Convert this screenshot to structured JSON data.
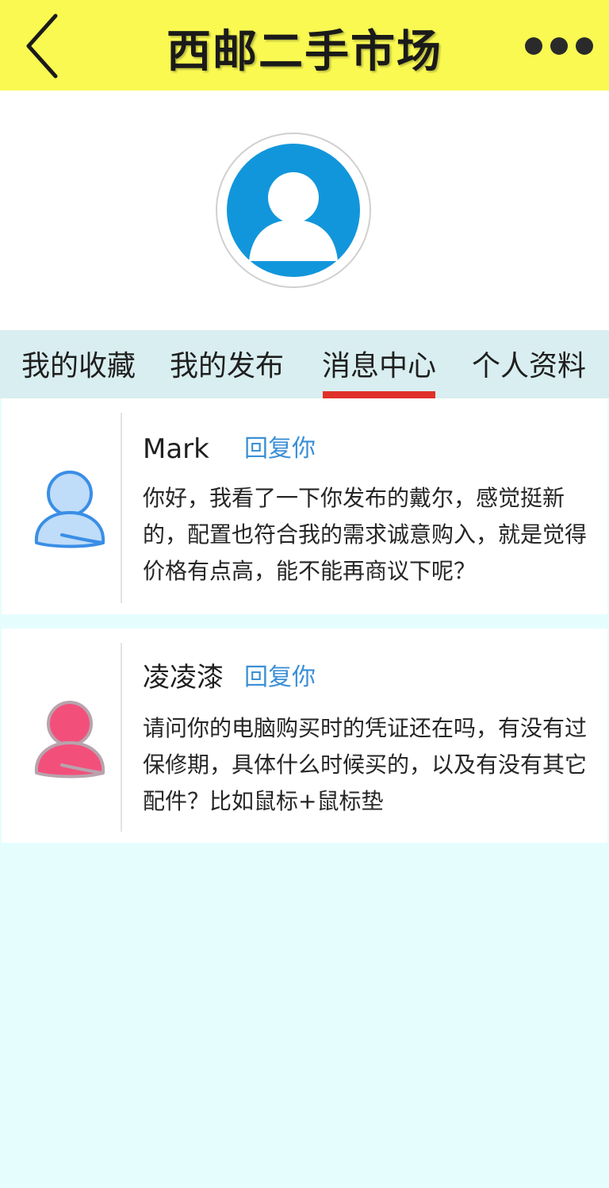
{
  "header": {
    "title": "西邮二手市场",
    "back_icon": "chevron-left-icon",
    "more_icon": "more-dots-icon",
    "background": "#f9f952"
  },
  "profile": {
    "avatar_icon": "user-avatar-icon",
    "avatar_color": "#1296db"
  },
  "tabs": [
    {
      "label": "我的收藏"
    },
    {
      "label": "我的发布"
    },
    {
      "label": "消息中心",
      "active": true
    },
    {
      "label": "个人资料"
    }
  ],
  "accent_color": "#e0302a",
  "messages": [
    {
      "name": "Mark",
      "reply_label": "回复你",
      "text": "你好，我看了一下你发布的戴尔，感觉挺新的，配置也符合我的需求诚意购入，就是觉得价格有点高，能不能再商议下呢？",
      "avatar_icon": "user-blue-icon",
      "avatar_color": "#3a8ee6"
    },
    {
      "name": "凌凌漆",
      "reply_label": "回复你",
      "text": "请问你的电脑购买时的凭证还在吗，有没有过保修期，具体什么时候买的，以及有没有其它配件？比如鼠标+鼠标垫",
      "avatar_icon": "user-pink-icon",
      "avatar_color": "#f2507b"
    }
  ]
}
